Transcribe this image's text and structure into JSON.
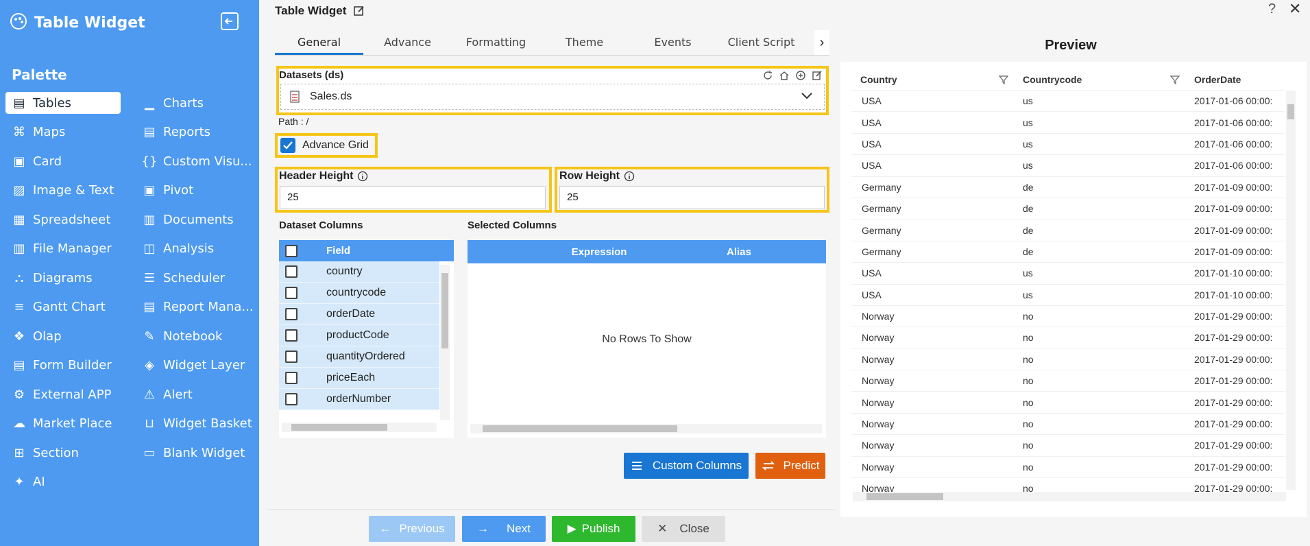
{
  "sidebar": {
    "title": "Table Widget",
    "palette_label": "Palette",
    "items_left": [
      {
        "label": "Tables",
        "icon": "table-icon"
      },
      {
        "label": "Maps",
        "icon": "map-icon"
      },
      {
        "label": "Card",
        "icon": "card-icon"
      },
      {
        "label": "Image & Text",
        "icon": "image-icon"
      },
      {
        "label": "Spreadsheet",
        "icon": "spreadsheet-icon"
      },
      {
        "label": "File Manager",
        "icon": "folder-icon"
      },
      {
        "label": "Diagrams",
        "icon": "diagram-icon"
      },
      {
        "label": "Gantt Chart",
        "icon": "gantt-icon"
      },
      {
        "label": "Olap",
        "icon": "olap-icon"
      },
      {
        "label": "Form Builder",
        "icon": "form-icon"
      },
      {
        "label": "External APP",
        "icon": "external-app-icon"
      },
      {
        "label": "Market Place",
        "icon": "marketplace-icon"
      },
      {
        "label": "Section",
        "icon": "section-icon"
      },
      {
        "label": "AI",
        "icon": "ai-sparkle-icon"
      }
    ],
    "items_right": [
      {
        "label": "Charts",
        "icon": "chart-icon"
      },
      {
        "label": "Reports",
        "icon": "report-icon"
      },
      {
        "label": "Custom Visu...",
        "icon": "custom-visual-icon"
      },
      {
        "label": "Pivot",
        "icon": "pivot-icon"
      },
      {
        "label": "Documents",
        "icon": "document-icon"
      },
      {
        "label": "Analysis",
        "icon": "analysis-icon"
      },
      {
        "label": "Scheduler",
        "icon": "scheduler-icon"
      },
      {
        "label": "Report Mana...",
        "icon": "report-manager-icon"
      },
      {
        "label": "Notebook",
        "icon": "notebook-icon"
      },
      {
        "label": "Widget Layer",
        "icon": "layer-icon"
      },
      {
        "label": "Alert",
        "icon": "alert-icon"
      },
      {
        "label": "Widget Basket",
        "icon": "basket-icon"
      },
      {
        "label": "Blank Widget",
        "icon": "blank-widget-icon"
      }
    ]
  },
  "header": {
    "title": "Table Widget"
  },
  "tabs": [
    "General",
    "Advance",
    "Formatting",
    "Theme",
    "Events",
    "Client Script"
  ],
  "dataset": {
    "label": "Datasets (ds)",
    "value": "Sales.ds",
    "path": "Path : /"
  },
  "advance_grid": {
    "label": "Advance Grid",
    "checked": true
  },
  "header_height": {
    "label": "Header Height",
    "value": "25"
  },
  "row_height": {
    "label": "Row Height",
    "value": "25"
  },
  "dataset_columns": {
    "label": "Dataset Columns",
    "header": "Field",
    "rows": [
      "country",
      "countrycode",
      "orderDate",
      "productCode",
      "quantityOrdered",
      "priceEach",
      "orderNumber"
    ]
  },
  "selected_columns": {
    "label": "Selected Columns",
    "headers": [
      "Expression",
      "Alias"
    ],
    "empty_text": "No Rows To Show"
  },
  "buttons": {
    "custom_columns": "Custom Columns",
    "predict": "Predict",
    "previous": "Previous",
    "next": "Next",
    "publish": "Publish",
    "close": "Close"
  },
  "preview": {
    "title": "Preview",
    "headers": [
      "Country",
      "Countrycode",
      "OrderDate"
    ],
    "rows": [
      [
        "USA",
        "us",
        "2017-01-06 00:00:"
      ],
      [
        "USA",
        "us",
        "2017-01-06 00:00:"
      ],
      [
        "USA",
        "us",
        "2017-01-06 00:00:"
      ],
      [
        "USA",
        "us",
        "2017-01-06 00:00:"
      ],
      [
        "Germany",
        "de",
        "2017-01-09 00:00:"
      ],
      [
        "Germany",
        "de",
        "2017-01-09 00:00:"
      ],
      [
        "Germany",
        "de",
        "2017-01-09 00:00:"
      ],
      [
        "Germany",
        "de",
        "2017-01-09 00:00:"
      ],
      [
        "USA",
        "us",
        "2017-01-10 00:00:"
      ],
      [
        "USA",
        "us",
        "2017-01-10 00:00:"
      ],
      [
        "Norway",
        "no",
        "2017-01-29 00:00:"
      ],
      [
        "Norway",
        "no",
        "2017-01-29 00:00:"
      ],
      [
        "Norway",
        "no",
        "2017-01-29 00:00:"
      ],
      [
        "Norway",
        "no",
        "2017-01-29 00:00:"
      ],
      [
        "Norway",
        "no",
        "2017-01-29 00:00:"
      ],
      [
        "Norway",
        "no",
        "2017-01-29 00:00:"
      ],
      [
        "Norway",
        "no",
        "2017-01-29 00:00:"
      ],
      [
        "Norway",
        "no",
        "2017-01-29 00:00:"
      ],
      [
        "Norway",
        "no",
        "2017-01-29 00:00:"
      ]
    ]
  },
  "colors": {
    "sidebar": "#4d9af0",
    "highlight": "#f5c518",
    "primary": "#1976d2",
    "publish": "#2eb82e",
    "predict": "#e06010"
  }
}
